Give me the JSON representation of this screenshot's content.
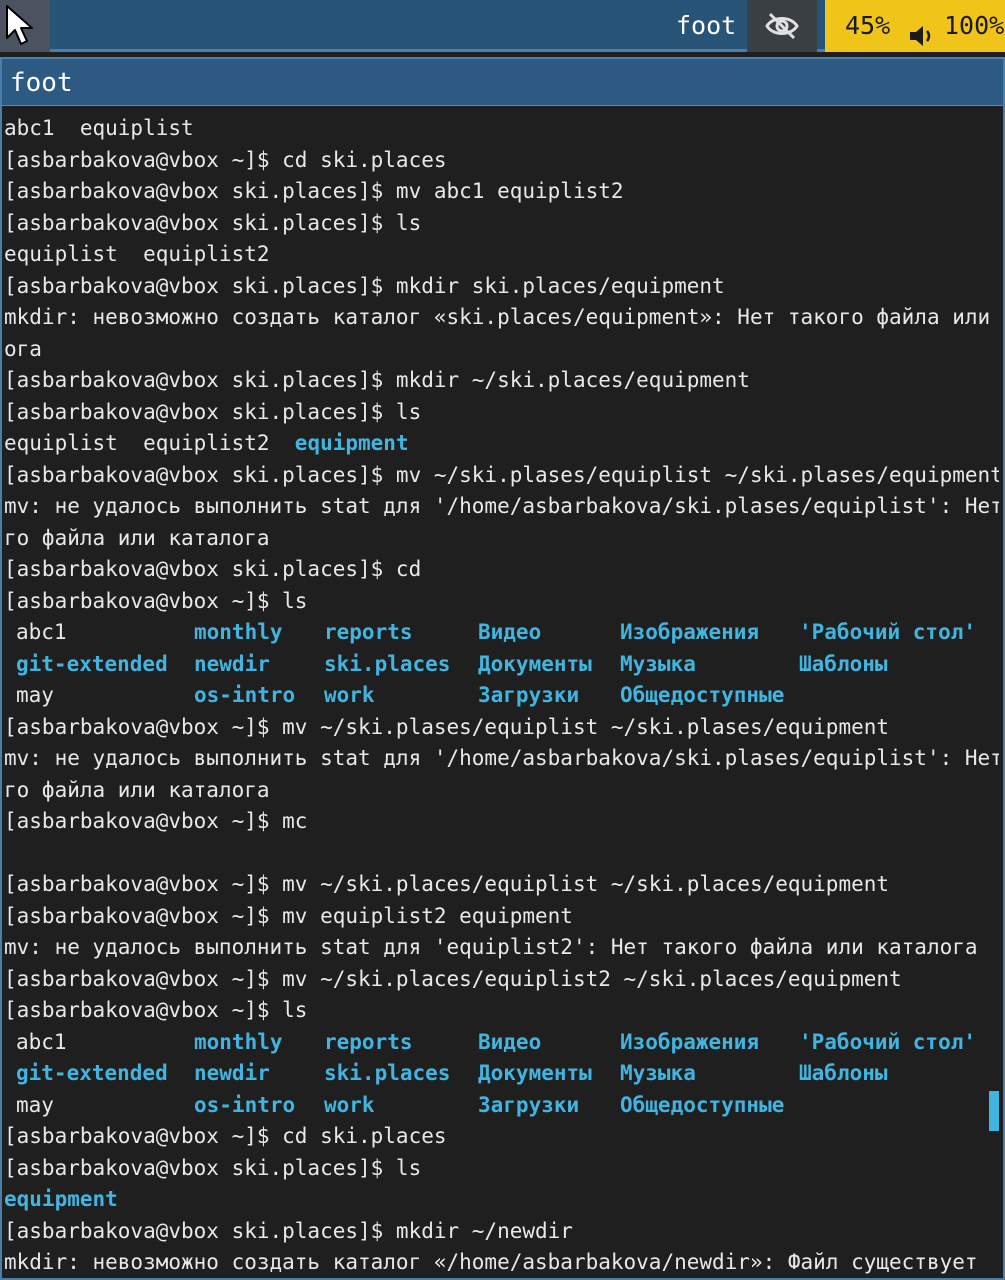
{
  "topbar": {
    "title": "foot",
    "battery": "45%",
    "volume": "100%",
    "icons": [
      "cursor-icon",
      "eye-slash-icon",
      "speaker-icon"
    ],
    "colors": {
      "bar": "#285577",
      "status": "#f0c419"
    }
  },
  "window": {
    "title": "foot"
  },
  "terminal": {
    "colors": {
      "text": "#e8e8e8",
      "directory": "#41b4e0",
      "background": "#1f1f1f"
    },
    "lines": [
      {
        "segments": [
          {
            "text": "abc1  equiplist"
          }
        ]
      },
      {
        "segments": [
          {
            "text": "[asbarbakova@vbox ~]$ cd ski.places"
          }
        ]
      },
      {
        "segments": [
          {
            "text": "[asbarbakova@vbox ski.places]$ mv abc1 equiplist2"
          }
        ]
      },
      {
        "segments": [
          {
            "text": "[asbarbakova@vbox ski.places]$ ls"
          }
        ]
      },
      {
        "segments": [
          {
            "text": "equiplist  equiplist2"
          }
        ]
      },
      {
        "segments": [
          {
            "text": "[asbarbakova@vbox ski.places]$ mkdir ski.places/equipment"
          }
        ]
      },
      {
        "segments": [
          {
            "text": "mkdir: невозможно создать каталог «ski.places/equipment»: Нет такого файла или катал"
          }
        ]
      },
      {
        "segments": [
          {
            "text": "ога"
          }
        ]
      },
      {
        "segments": [
          {
            "text": "[asbarbakova@vbox ski.places]$ mkdir ~/ski.places/equipment"
          }
        ]
      },
      {
        "segments": [
          {
            "text": "[asbarbakova@vbox ski.places]$ ls"
          }
        ]
      },
      {
        "segments": [
          {
            "text": "equiplist  equiplist2  "
          },
          {
            "text": "equipment",
            "dir": true
          }
        ]
      },
      {
        "segments": [
          {
            "text": "[asbarbakova@vbox ski.places]$ mv ~/ski.plases/equiplist ~/ski.plases/equipment"
          }
        ]
      },
      {
        "segments": [
          {
            "text": "mv: не удалось выполнить stat для '/home/asbarbakova/ski.plases/equiplist': Нет тако"
          }
        ]
      },
      {
        "segments": [
          {
            "text": "го файла или каталога"
          }
        ]
      },
      {
        "segments": [
          {
            "text": "[asbarbakova@vbox ski.places]$ cd"
          }
        ]
      },
      {
        "segments": [
          {
            "text": "[asbarbakova@vbox ~]$ ls"
          }
        ]
      },
      {
        "cells": [
          {
            "text": "abc1"
          },
          {
            "text": "monthly",
            "dir": true
          },
          {
            "text": "reports",
            "dir": true
          },
          {
            "text": "Видео",
            "dir": true
          },
          {
            "text": "Изображения",
            "dir": true
          },
          {
            "text": "'Рабочий стол'",
            "dir": true
          }
        ]
      },
      {
        "cells": [
          {
            "text": "git-extended",
            "dir": true
          },
          {
            "text": "newdir",
            "dir": true
          },
          {
            "text": "ski.places",
            "dir": true
          },
          {
            "text": "Документы",
            "dir": true
          },
          {
            "text": "Музыка",
            "dir": true
          },
          {
            "text": "Шаблоны",
            "dir": true
          }
        ]
      },
      {
        "cells": [
          {
            "text": "may"
          },
          {
            "text": "os-intro",
            "dir": true
          },
          {
            "text": "work",
            "dir": true
          },
          {
            "text": "Загрузки",
            "dir": true
          },
          {
            "text": "Общедоступные",
            "dir": true
          },
          {
            "text": ""
          }
        ]
      },
      {
        "segments": [
          {
            "text": "[asbarbakova@vbox ~]$ mv ~/ski.plases/equiplist ~/ski.plases/equipment"
          }
        ]
      },
      {
        "segments": [
          {
            "text": "mv: не удалось выполнить stat для '/home/asbarbakova/ski.plases/equiplist': Нет тако"
          }
        ]
      },
      {
        "segments": [
          {
            "text": "го файла или каталога"
          }
        ]
      },
      {
        "segments": [
          {
            "text": "[asbarbakova@vbox ~]$ mc"
          }
        ]
      },
      {
        "segments": [
          {
            "text": ""
          }
        ]
      },
      {
        "segments": [
          {
            "text": "[asbarbakova@vbox ~]$ mv ~/ski.places/equiplist ~/ski.places/equipment"
          }
        ]
      },
      {
        "segments": [
          {
            "text": "[asbarbakova@vbox ~]$ mv equiplist2 equipment"
          }
        ]
      },
      {
        "segments": [
          {
            "text": "mv: не удалось выполнить stat для 'equiplist2': Нет такого файла или каталога"
          }
        ]
      },
      {
        "segments": [
          {
            "text": "[asbarbakova@vbox ~]$ mv ~/ski.places/equiplist2 ~/ski.places/equipment"
          }
        ]
      },
      {
        "segments": [
          {
            "text": "[asbarbakova@vbox ~]$ ls"
          }
        ]
      },
      {
        "cells": [
          {
            "text": "abc1"
          },
          {
            "text": "monthly",
            "dir": true
          },
          {
            "text": "reports",
            "dir": true
          },
          {
            "text": "Видео",
            "dir": true
          },
          {
            "text": "Изображения",
            "dir": true
          },
          {
            "text": "'Рабочий стол'",
            "dir": true
          }
        ]
      },
      {
        "cells": [
          {
            "text": "git-extended",
            "dir": true
          },
          {
            "text": "newdir",
            "dir": true
          },
          {
            "text": "ski.places",
            "dir": true
          },
          {
            "text": "Документы",
            "dir": true
          },
          {
            "text": "Музыка",
            "dir": true
          },
          {
            "text": "Шаблоны",
            "dir": true
          }
        ]
      },
      {
        "cells": [
          {
            "text": "may"
          },
          {
            "text": "os-intro",
            "dir": true
          },
          {
            "text": "work",
            "dir": true
          },
          {
            "text": "Загрузки",
            "dir": true
          },
          {
            "text": "Общедоступные",
            "dir": true
          },
          {
            "text": ""
          }
        ]
      },
      {
        "segments": [
          {
            "text": "[asbarbakova@vbox ~]$ cd ski.places"
          }
        ]
      },
      {
        "segments": [
          {
            "text": "[asbarbakova@vbox ski.places]$ ls"
          }
        ]
      },
      {
        "segments": [
          {
            "text": "equipment",
            "dir": true
          }
        ]
      },
      {
        "segments": [
          {
            "text": "[asbarbakova@vbox ski.places]$ mkdir ~/newdir"
          }
        ]
      },
      {
        "segments": [
          {
            "text": "mkdir: невозможно создать каталог «/home/asbarbakova/newdir»: Файл существует"
          }
        ]
      }
    ]
  }
}
